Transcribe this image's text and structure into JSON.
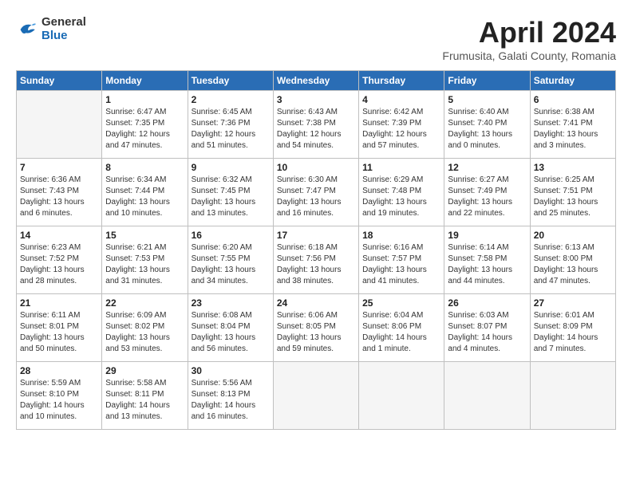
{
  "header": {
    "logo_general": "General",
    "logo_blue": "Blue",
    "month_title": "April 2024",
    "location": "Frumusita, Galati County, Romania"
  },
  "weekdays": [
    "Sunday",
    "Monday",
    "Tuesday",
    "Wednesday",
    "Thursday",
    "Friday",
    "Saturday"
  ],
  "weeks": [
    [
      {
        "day": "",
        "info": ""
      },
      {
        "day": "1",
        "info": "Sunrise: 6:47 AM\nSunset: 7:35 PM\nDaylight: 12 hours\nand 47 minutes."
      },
      {
        "day": "2",
        "info": "Sunrise: 6:45 AM\nSunset: 7:36 PM\nDaylight: 12 hours\nand 51 minutes."
      },
      {
        "day": "3",
        "info": "Sunrise: 6:43 AM\nSunset: 7:38 PM\nDaylight: 12 hours\nand 54 minutes."
      },
      {
        "day": "4",
        "info": "Sunrise: 6:42 AM\nSunset: 7:39 PM\nDaylight: 12 hours\nand 57 minutes."
      },
      {
        "day": "5",
        "info": "Sunrise: 6:40 AM\nSunset: 7:40 PM\nDaylight: 13 hours\nand 0 minutes."
      },
      {
        "day": "6",
        "info": "Sunrise: 6:38 AM\nSunset: 7:41 PM\nDaylight: 13 hours\nand 3 minutes."
      }
    ],
    [
      {
        "day": "7",
        "info": "Sunrise: 6:36 AM\nSunset: 7:43 PM\nDaylight: 13 hours\nand 6 minutes."
      },
      {
        "day": "8",
        "info": "Sunrise: 6:34 AM\nSunset: 7:44 PM\nDaylight: 13 hours\nand 10 minutes."
      },
      {
        "day": "9",
        "info": "Sunrise: 6:32 AM\nSunset: 7:45 PM\nDaylight: 13 hours\nand 13 minutes."
      },
      {
        "day": "10",
        "info": "Sunrise: 6:30 AM\nSunset: 7:47 PM\nDaylight: 13 hours\nand 16 minutes."
      },
      {
        "day": "11",
        "info": "Sunrise: 6:29 AM\nSunset: 7:48 PM\nDaylight: 13 hours\nand 19 minutes."
      },
      {
        "day": "12",
        "info": "Sunrise: 6:27 AM\nSunset: 7:49 PM\nDaylight: 13 hours\nand 22 minutes."
      },
      {
        "day": "13",
        "info": "Sunrise: 6:25 AM\nSunset: 7:51 PM\nDaylight: 13 hours\nand 25 minutes."
      }
    ],
    [
      {
        "day": "14",
        "info": "Sunrise: 6:23 AM\nSunset: 7:52 PM\nDaylight: 13 hours\nand 28 minutes."
      },
      {
        "day": "15",
        "info": "Sunrise: 6:21 AM\nSunset: 7:53 PM\nDaylight: 13 hours\nand 31 minutes."
      },
      {
        "day": "16",
        "info": "Sunrise: 6:20 AM\nSunset: 7:55 PM\nDaylight: 13 hours\nand 34 minutes."
      },
      {
        "day": "17",
        "info": "Sunrise: 6:18 AM\nSunset: 7:56 PM\nDaylight: 13 hours\nand 38 minutes."
      },
      {
        "day": "18",
        "info": "Sunrise: 6:16 AM\nSunset: 7:57 PM\nDaylight: 13 hours\nand 41 minutes."
      },
      {
        "day": "19",
        "info": "Sunrise: 6:14 AM\nSunset: 7:58 PM\nDaylight: 13 hours\nand 44 minutes."
      },
      {
        "day": "20",
        "info": "Sunrise: 6:13 AM\nSunset: 8:00 PM\nDaylight: 13 hours\nand 47 minutes."
      }
    ],
    [
      {
        "day": "21",
        "info": "Sunrise: 6:11 AM\nSunset: 8:01 PM\nDaylight: 13 hours\nand 50 minutes."
      },
      {
        "day": "22",
        "info": "Sunrise: 6:09 AM\nSunset: 8:02 PM\nDaylight: 13 hours\nand 53 minutes."
      },
      {
        "day": "23",
        "info": "Sunrise: 6:08 AM\nSunset: 8:04 PM\nDaylight: 13 hours\nand 56 minutes."
      },
      {
        "day": "24",
        "info": "Sunrise: 6:06 AM\nSunset: 8:05 PM\nDaylight: 13 hours\nand 59 minutes."
      },
      {
        "day": "25",
        "info": "Sunrise: 6:04 AM\nSunset: 8:06 PM\nDaylight: 14 hours\nand 1 minute."
      },
      {
        "day": "26",
        "info": "Sunrise: 6:03 AM\nSunset: 8:07 PM\nDaylight: 14 hours\nand 4 minutes."
      },
      {
        "day": "27",
        "info": "Sunrise: 6:01 AM\nSunset: 8:09 PM\nDaylight: 14 hours\nand 7 minutes."
      }
    ],
    [
      {
        "day": "28",
        "info": "Sunrise: 5:59 AM\nSunset: 8:10 PM\nDaylight: 14 hours\nand 10 minutes."
      },
      {
        "day": "29",
        "info": "Sunrise: 5:58 AM\nSunset: 8:11 PM\nDaylight: 14 hours\nand 13 minutes."
      },
      {
        "day": "30",
        "info": "Sunrise: 5:56 AM\nSunset: 8:13 PM\nDaylight: 14 hours\nand 16 minutes."
      },
      {
        "day": "",
        "info": ""
      },
      {
        "day": "",
        "info": ""
      },
      {
        "day": "",
        "info": ""
      },
      {
        "day": "",
        "info": ""
      }
    ]
  ]
}
